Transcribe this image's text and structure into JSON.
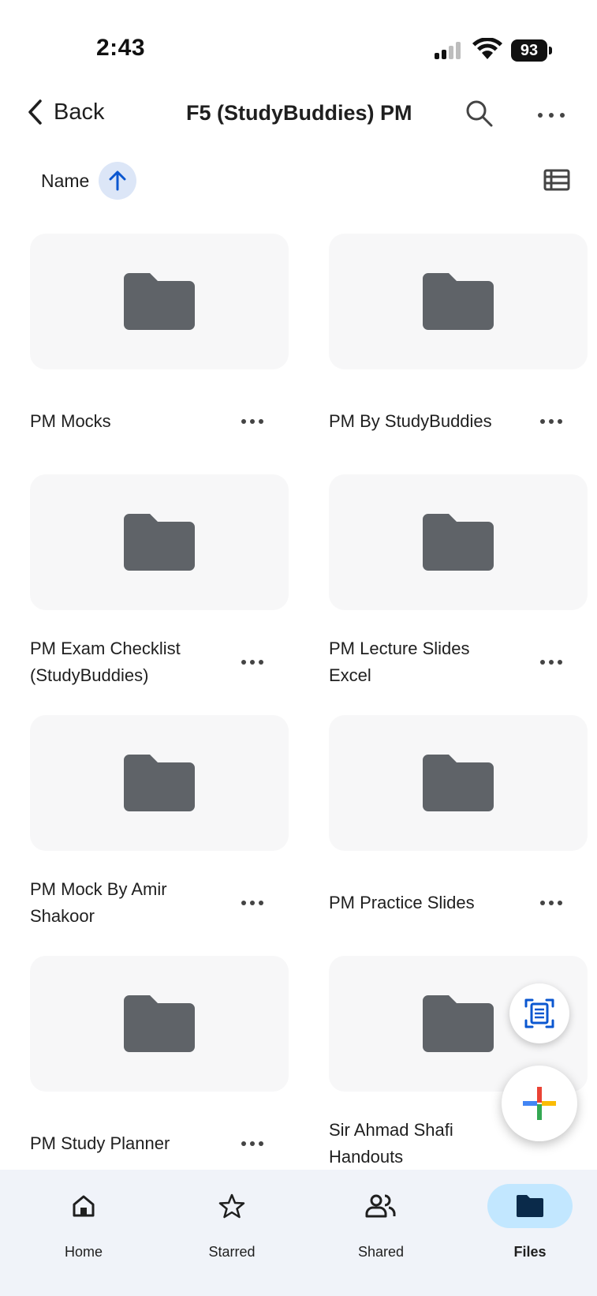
{
  "status": {
    "time": "2:43",
    "battery": "93",
    "signal_icon": "cellular-signal-icon",
    "wifi_icon": "wifi-icon"
  },
  "header": {
    "back_label": "Back",
    "title": "F5 (StudyBuddies) PM",
    "search_icon": "search-icon",
    "more_icon": "more-horizontal-icon"
  },
  "sort": {
    "label": "Name",
    "direction": "ascending"
  },
  "folders": [
    {
      "name": "PM Mocks"
    },
    {
      "name": "PM By StudyBuddies"
    },
    {
      "name": "PM Exam Checklist (StudyBuddies)"
    },
    {
      "name": "PM Lecture Slides Excel"
    },
    {
      "name": "PM Mock By Amir Shakoor"
    },
    {
      "name": "PM Practice Slides"
    },
    {
      "name": "PM Study Planner"
    },
    {
      "name": "Sir Ahmad Shafi Handouts"
    }
  ],
  "bottom_nav": [
    {
      "label": "Home",
      "icon": "home-icon",
      "active": false
    },
    {
      "label": "Starred",
      "icon": "star-icon",
      "active": false
    },
    {
      "label": "Shared",
      "icon": "shared-people-icon",
      "active": false
    },
    {
      "label": "Files",
      "icon": "folder-icon",
      "active": true
    }
  ],
  "colors": {
    "folder": "#5f6368",
    "tile_bg": "#f7f7f8",
    "active_nav": "#c2e7ff",
    "sort_chip": "#dce6f7",
    "accent_blue": "#0b57d0"
  }
}
